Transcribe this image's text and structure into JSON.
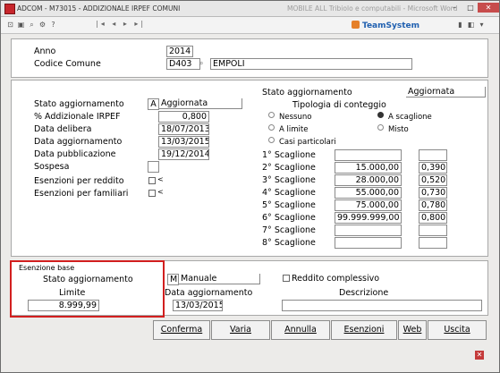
{
  "window": {
    "title": "ADCOM - M73015 - ADDIZIONALE IRPEF COMUNI",
    "blurred_title": "MOBILE ALL Tribiolo e computabili - Microsoft Word"
  },
  "toolbar": {
    "nav": "|◂ ◂ ▸ ▸|",
    "brand": "TeamSystem"
  },
  "header": {
    "anno_label": "Anno",
    "anno_value": "2014",
    "codice_label": "Codice Comune",
    "codice_value": "D403",
    "comune_value": "EMPOLI"
  },
  "left": {
    "stato_label": "Stato aggiornamento",
    "stato_code": "A",
    "stato_value": "Aggiornata",
    "perc_label": "% Addizionale IRPEF",
    "perc_value": "0,800",
    "data_delibera_label": "Data delibera",
    "data_delibera_value": "18/07/2013",
    "data_agg_label": "Data aggiornamento",
    "data_agg_value": "13/03/2015",
    "data_pub_label": "Data pubblicazione",
    "data_pub_value": "19/12/2014",
    "sospesa_label": "Sospesa",
    "sospesa_value": "",
    "esenz_reddito_label": "Esenzioni per reddito",
    "esenz_reddito_sym": "<",
    "esenz_familiari_label": "Esenzioni per familiari",
    "esenz_familiari_sym": "<"
  },
  "right": {
    "stato_label": "Stato aggiornamento",
    "stato_value": "Aggiornata",
    "tipologia_label": "Tipologia di conteggio",
    "radios": {
      "nessuno": "Nessuno",
      "a_scaglione": "A scaglione",
      "a_limite": "A limite",
      "misto": "Misto",
      "casi": "Casi particolari"
    },
    "scaglioni": [
      {
        "label": "1° Scaglione",
        "amount": "",
        "rate": ""
      },
      {
        "label": "2° Scaglione",
        "amount": "15.000,00",
        "rate": "0,390"
      },
      {
        "label": "3° Scaglione",
        "amount": "28.000,00",
        "rate": "0,520"
      },
      {
        "label": "4° Scaglione",
        "amount": "55.000,00",
        "rate": "0,730"
      },
      {
        "label": "5° Scaglione",
        "amount": "75.000,00",
        "rate": "0,780"
      },
      {
        "label": "6° Scaglione",
        "amount": "99.999.999,00",
        "rate": "0,800"
      },
      {
        "label": "7° Scaglione",
        "amount": "",
        "rate": ""
      },
      {
        "label": "8° Scaglione",
        "amount": "",
        "rate": ""
      }
    ]
  },
  "esenzione": {
    "group_label": "Esenzione base",
    "stato_label": "Stato aggiornamento",
    "stato_code": "M",
    "stato_value": "Manuale",
    "limite_label": "Limite",
    "limite_value": "8.999,99",
    "data_agg_label": "Data aggiornamento",
    "data_agg_value": "13/03/2015",
    "reddito_label": "Reddito complessivo",
    "descrizione_label": "Descrizione",
    "descrizione_value": ""
  },
  "buttons": {
    "conferma": "Conferma",
    "varia": "Varia",
    "annulla": "Annulla",
    "esenzioni": "Esenzioni",
    "web": "Web",
    "uscita": "Uscita"
  }
}
